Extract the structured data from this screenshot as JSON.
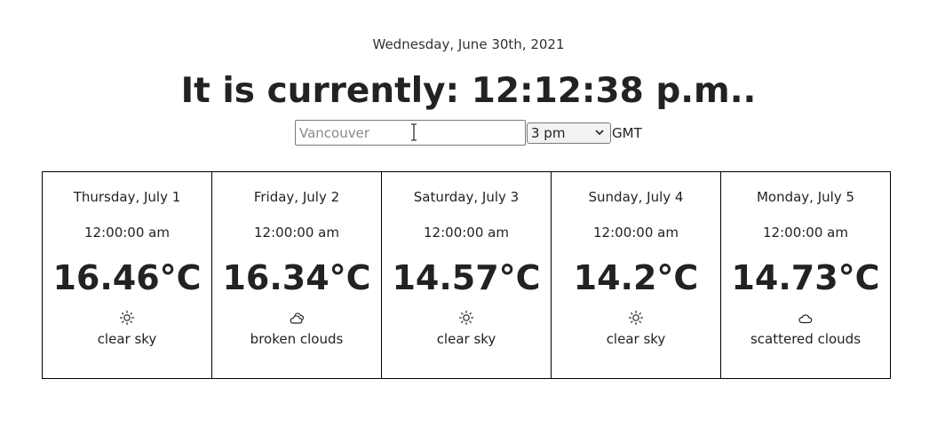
{
  "header": {
    "date": "Wednesday, June 30th, 2021",
    "clock": "It is currently: 12:12:38 p.m.."
  },
  "controls": {
    "city_placeholder": "Vancouver",
    "time_selected": "3 pm",
    "timezone_label": "GMT"
  },
  "forecast": [
    {
      "day": "Thursday, July 1",
      "time": "12:00:00 am",
      "temp": "16.46°C",
      "icon": "sun-icon",
      "desc": "clear sky"
    },
    {
      "day": "Friday, July 2",
      "time": "12:00:00 am",
      "temp": "16.34°C",
      "icon": "broken-clouds-icon",
      "desc": "broken clouds"
    },
    {
      "day": "Saturday, July 3",
      "time": "12:00:00 am",
      "temp": "14.57°C",
      "icon": "sun-icon",
      "desc": "clear sky"
    },
    {
      "day": "Sunday, July 4",
      "time": "12:00:00 am",
      "temp": "14.2°C",
      "icon": "sun-icon",
      "desc": "clear sky"
    },
    {
      "day": "Monday, July 5",
      "time": "12:00:00 am",
      "temp": "14.73°C",
      "icon": "cloud-icon",
      "desc": "scattered clouds"
    }
  ]
}
